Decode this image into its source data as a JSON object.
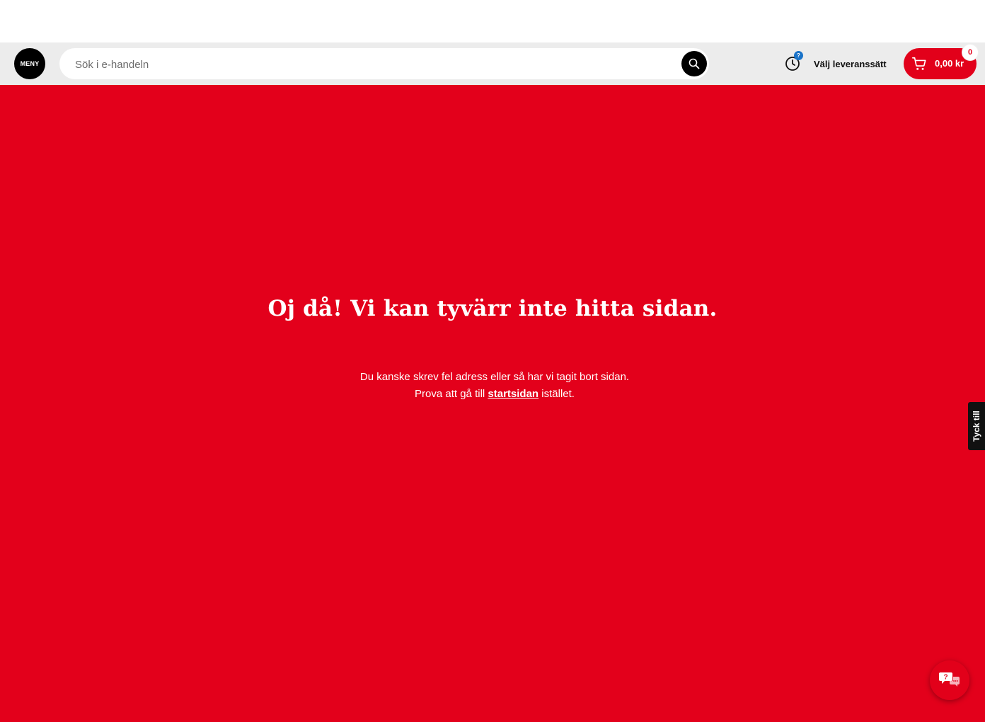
{
  "header": {
    "logo_text": "MENY",
    "search": {
      "placeholder": "Sök i e-handeln"
    },
    "delivery": {
      "badge": "?",
      "label": "Välj leveranssätt"
    },
    "cart": {
      "total": "0,00 kr",
      "count": "0"
    }
  },
  "main": {
    "heading": "Oj då! Vi kan tyvärr inte hitta sidan.",
    "message_before": "Du kanske skrev fel adress eller så har vi tagit bort sidan. Prova att gå till",
    "link_label": "startsidan",
    "message_after": "istället."
  },
  "feedback_tab_label": "Tyck till",
  "icons": {
    "search": "search-icon",
    "clock": "clock-icon",
    "cart": "cart-icon",
    "help": "help-chat-icon"
  },
  "colors": {
    "brand_red": "#e3001b",
    "header_bg": "#ececec",
    "badge_blue": "#1a73c8"
  }
}
